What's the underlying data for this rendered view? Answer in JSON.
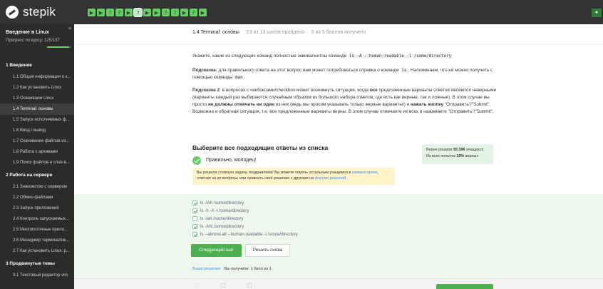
{
  "header": {
    "logo": "stepik",
    "steps": [
      "▶",
      "▶",
      "?",
      "?",
      "▶",
      "?",
      "▶",
      "▶",
      "?",
      "?",
      "▶",
      "?",
      "▶"
    ],
    "current_step_index": 5
  },
  "sidebar": {
    "course_title": "Введение в Linux",
    "progress_text": "Прогресс по курсу: 125/137",
    "progress_fraction": 0.912,
    "sections": [
      {
        "title": "1 Введение",
        "lessons": [
          "1.1 Общая информация о к...",
          "1.2 Как установить Linux",
          "1.3 Осваиваем Linux",
          "1.4 Terminal: основы",
          "1.5 Запуск исполняемых ф...",
          "1.6 Ввод / вывод",
          "1.7 Скачивание файлов из...",
          "1.8 Работа с архивами",
          "1.9 Поиск файлов и слов в..."
        ]
      },
      {
        "title": "2 Работа на сервере",
        "lessons": [
          "2.1 Знакомство с сервером",
          "2.2 Обмен файлами",
          "2.3 Запуск приложений",
          "2.4 Контроль запускаемых...",
          "2.5 Многопоточные прило...",
          "2.6 Менеджер терминалов...",
          "2.7 Как установить Linux: р..."
        ]
      },
      {
        "title": "3 Продвинутые темы",
        "lessons": [
          "3.1 Текстовый редактор vim"
        ]
      }
    ],
    "active_lesson": "1.4 Terminal: основы"
  },
  "lesson": {
    "title": "1.4 Terminal: основы",
    "steps_meta": "13 из 13 шагов пройдено",
    "score_meta": "5 из 5 баллов получено"
  },
  "question": {
    "p1_a": "Укажите, какие из следующих команд полностью эквивалентны команде",
    "p1_code": "ls -A --human-readable -l /some/directory",
    "p2_bold": "Подсказка:",
    "p2_a": "для правильного ответа на этот вопрос вам может потребоваться справка о команде",
    "p2_code1": "ls",
    "p2_b": ". Напоминаем, что её можно получить с помощью команды",
    "p2_code2": "man",
    "p2_c": ".",
    "p3_bold": "Подсказка 2",
    "p3_a": ": в вопросах с чекбоксами/checkbox может возникнуть ситуация, когда",
    "p3_b_bold": "все",
    "p3_c": "предложенные варианты ответов являются неверными (варианты каждый раз выбираются случайным образом из большого набора ответов, где есть как верные, так и ложные). В этом случае вы просто",
    "p3_d_bold": "не должны отмечать ни один",
    "p3_e": "из них (ведь мы просим указывать только верные варианты!) и",
    "p3_f_bold": "нажать кнопку",
    "p3_g": "\"Отправить\"/\"Submit\". Возможна и обратная ситуация, т.е. все предложенные варианты верны. В этом случае отмечаете их всех и нажимаете \"Отправить\"/\"Submit\"."
  },
  "result": {
    "title": "Выберите все подходящие ответы из списка",
    "correct": "Правильно, молодец!",
    "notice_a": "Вы решили сложную задачу, поздравляем! Вы можете помочь остальным учащимся в",
    "notice_link1": "комментариях",
    "notice_b": ", отвечая на их вопросы, или сравнить своё решение с другими на",
    "notice_link2": "форуме решений",
    "notice_c": ".",
    "stats_a": "Верно решили",
    "stats_count": "55 396",
    "stats_b": "учащихся",
    "stats_c": "Из всех попыток",
    "stats_pct": "19%",
    "stats_d": "верных"
  },
  "answers": [
    {
      "label": "ls -lAh /some/directory",
      "checked": true
    },
    {
      "label": "ls -h -A -l /some/directory",
      "checked": true
    },
    {
      "label": "ls -lah /some/directory",
      "checked": false
    },
    {
      "label": "ls -Ahl /some/directory",
      "checked": true
    },
    {
      "label": "ls --almost-all --human-readable -l /some/directory",
      "checked": true
    }
  ],
  "actions": {
    "next": "Следующий шаг",
    "retry": "Решить снова"
  },
  "solutions": {
    "link": "Ваши решения",
    "score": "Вы получили: 1 балл из 1"
  },
  "colors": {
    "accent": "#66cc66",
    "button": "#4caf50",
    "sidebar": "#2b2b2b",
    "topbar": "#333333",
    "notice": "#fdf2c8"
  }
}
